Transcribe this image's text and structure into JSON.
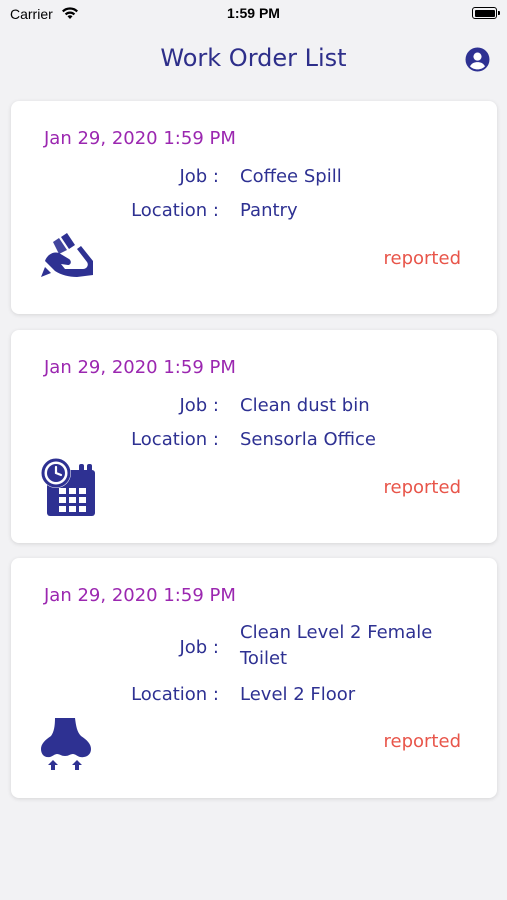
{
  "status_bar": {
    "carrier": "Carrier",
    "time": "1:59 PM"
  },
  "nav": {
    "title": "Work Order List",
    "profile_icon": "user-circle-icon"
  },
  "labels": {
    "job": "Job :",
    "location": "Location :"
  },
  "work_orders": [
    {
      "date": "Jan 29, 2020 1:59 PM",
      "job": "Coffee Spill",
      "location": "Pantry",
      "status": "reported",
      "icon": "hand-writing-icon"
    },
    {
      "date": "Jan 29, 2020 1:59 PM",
      "job": "Clean dust bin",
      "location": "Sensorla Office",
      "status": "reported",
      "icon": "calendar-clock-icon"
    },
    {
      "date": "Jan 29, 2020 1:59 PM",
      "job": "Clean Level 2 Female Toilet",
      "location": "Level 2 Floor",
      "status": "reported",
      "icon": "nose-smell-icon"
    }
  ],
  "colors": {
    "title": "#2e2f8a",
    "date": "#9b27b0",
    "text": "#2e3192",
    "status": "#e8554a",
    "icon": "#2e3192"
  }
}
